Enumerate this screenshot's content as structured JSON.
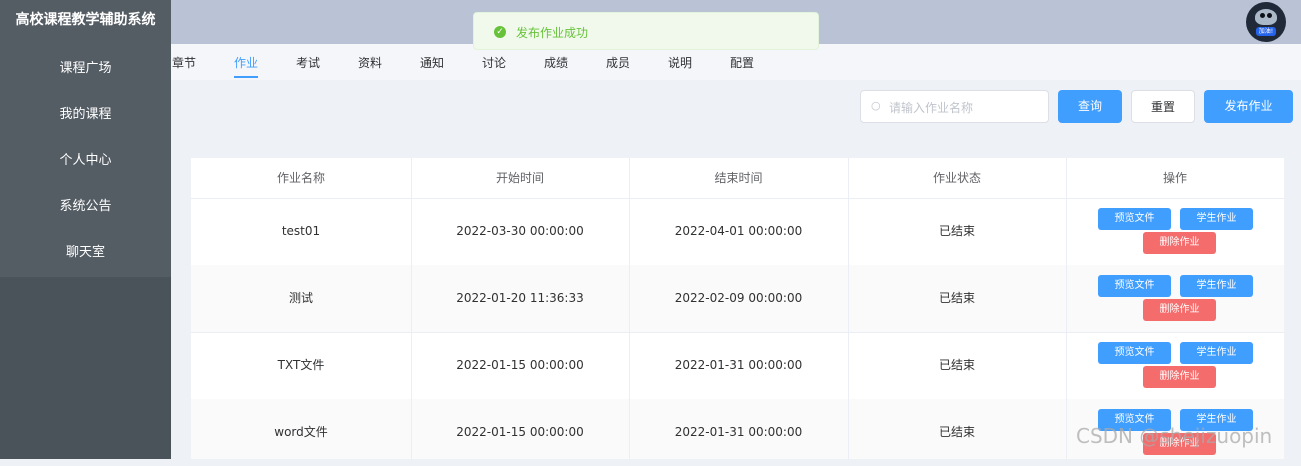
{
  "app": {
    "title": "高校课程教学辅助系统"
  },
  "sidebar": {
    "items": [
      {
        "label": "课程广场"
      },
      {
        "label": "我的课程"
      },
      {
        "label": "个人中心"
      },
      {
        "label": "系统公告"
      },
      {
        "label": "聊天室"
      }
    ]
  },
  "header": {
    "avatar_badge": "加油!"
  },
  "toast": {
    "message": "发布作业成功",
    "icon": "check-circle-icon",
    "color": "#67c23a"
  },
  "tabs": [
    {
      "label": "章节"
    },
    {
      "label": "作业",
      "active": true
    },
    {
      "label": "考试"
    },
    {
      "label": "资料"
    },
    {
      "label": "通知"
    },
    {
      "label": "讨论"
    },
    {
      "label": "成绩"
    },
    {
      "label": "成员"
    },
    {
      "label": "说明"
    },
    {
      "label": "配置"
    }
  ],
  "search": {
    "placeholder": "请输入作业名称",
    "value": "",
    "icon": "search-icon"
  },
  "buttons": {
    "query": "查询",
    "reset": "重置",
    "publish": "发布作业"
  },
  "table": {
    "headers": [
      "作业名称",
      "开始时间",
      "结束时间",
      "作业状态",
      "操作"
    ],
    "rows": [
      {
        "name": "test01",
        "start": "2022-03-30 00:00:00",
        "end": "2022-04-01 00:00:00",
        "status": "已结束"
      },
      {
        "name": "测试",
        "start": "2022-01-20 11:36:33",
        "end": "2022-02-09 00:00:00",
        "status": "已结束"
      },
      {
        "name": "TXT文件",
        "start": "2022-01-15 00:00:00",
        "end": "2022-01-31 00:00:00",
        "status": "已结束"
      },
      {
        "name": "word文件",
        "start": "2022-01-15 00:00:00",
        "end": "2022-01-31 00:00:00",
        "status": "已结束"
      }
    ],
    "actions": {
      "preview": "预览文件",
      "student": "学生作业",
      "delete": "删除作业"
    }
  },
  "colors": {
    "primary": "#409eff",
    "danger": "#f56c6c",
    "sidebar": "#545c64"
  },
  "watermark": "CSDN @shejizuopin"
}
